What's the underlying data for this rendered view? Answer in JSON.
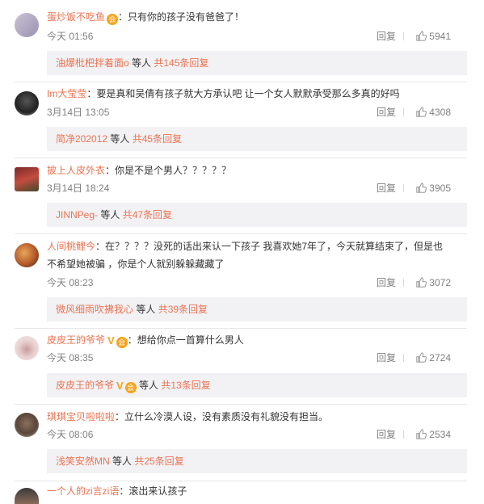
{
  "comments": [
    {
      "username": "蛋炒饭不吃鱼",
      "text": "：只有你的孩子没有爸爸了！",
      "time": "今天 01:56",
      "reply_label": "回复",
      "likes": "5941",
      "sub_user": "油爆枇杷拌着面o",
      "sub_mid": " 等人 ",
      "sub_count": "共145条回复"
    },
    {
      "username": "Im大莹莹",
      "text": "：要是真和吴倩有孩子就大方承认吧 让一个女人默默承受那么多真的好吗",
      "time": "3月14日 13:05",
      "reply_label": "回复",
      "likes": "4308",
      "sub_user": "简净202012",
      "sub_mid": " 等人 ",
      "sub_count": "共45条回复"
    },
    {
      "username": "披上人皮外衣",
      "text": "：你是不是个男人？？？？？",
      "time": "3月14日 18:24",
      "reply_label": "回复",
      "likes": "3905",
      "sub_user": "JINNPeg-",
      "sub_mid": " 等人 ",
      "sub_count": "共47条回复"
    },
    {
      "username": "人间桃鲤今",
      "text": "：在？？？？没死的话出来认一下孩子  我喜欢她7年了，今天就算结束了，但是也",
      "text2": "不希望她被骗 ，你是个人就别躲躲藏藏了",
      "time": "今天 08:23",
      "reply_label": "回复",
      "likes": "3072",
      "sub_user": "微风细雨吹拂我心",
      "sub_mid": " 等人 ",
      "sub_count": "共39条回复"
    },
    {
      "username": "皮皮王的爷爷",
      "text": "：想给你点一首算什么男人",
      "time": "今天 08:35",
      "reply_label": "回复",
      "likes": "2724",
      "sub_user": "皮皮王的爷爷",
      "sub_mid": " 等人 ",
      "sub_count": "共13条回复"
    },
    {
      "username": "琪琪宝贝啦啦啦",
      "text": "：立什么冷漠人设，没有素质没有礼貌没有担当。",
      "time": "今天 08:06",
      "reply_label": "回复",
      "likes": "2534",
      "sub_user": "浅笑安然MN",
      "sub_mid": " 等人 ",
      "sub_count": "共25条回复"
    },
    {
      "username": "一个人的zi言zi语",
      "text": "：滚出来认孩子"
    }
  ],
  "colors": {
    "username": "#eb7350",
    "meta": "#808080",
    "subbox_bg": "#f2f2f5"
  },
  "icons": {
    "like": "thumbs-up-icon",
    "badge": "member-badge-icon",
    "verified": "v-badge-icon"
  }
}
